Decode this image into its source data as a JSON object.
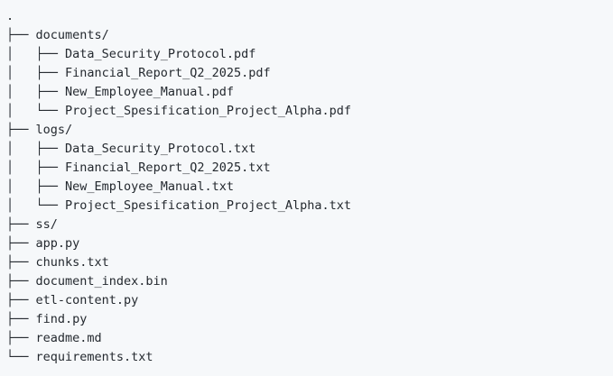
{
  "tree": {
    "lines": [
      {
        "prefix": ".",
        "name": ""
      },
      {
        "prefix": "├── ",
        "name": "documents/"
      },
      {
        "prefix": "│   ├── ",
        "name": "Data_Security_Protocol.pdf"
      },
      {
        "prefix": "│   ├── ",
        "name": "Financial_Report_Q2_2025.pdf"
      },
      {
        "prefix": "│   ├── ",
        "name": "New_Employee_Manual.pdf"
      },
      {
        "prefix": "│   └── ",
        "name": "Project_Spesification_Project_Alpha.pdf"
      },
      {
        "prefix": "├── ",
        "name": "logs/"
      },
      {
        "prefix": "│   ├── ",
        "name": "Data_Security_Protocol.txt"
      },
      {
        "prefix": "│   ├── ",
        "name": "Financial_Report_Q2_2025.txt"
      },
      {
        "prefix": "│   ├── ",
        "name": "New_Employee_Manual.txt"
      },
      {
        "prefix": "│   └── ",
        "name": "Project_Spesification_Project_Alpha.txt"
      },
      {
        "prefix": "├── ",
        "name": "ss/"
      },
      {
        "prefix": "├── ",
        "name": "app.py"
      },
      {
        "prefix": "├── ",
        "name": "chunks.txt"
      },
      {
        "prefix": "├── ",
        "name": "document_index.bin"
      },
      {
        "prefix": "├── ",
        "name": "etl-content.py"
      },
      {
        "prefix": "├── ",
        "name": "find.py"
      },
      {
        "prefix": "├── ",
        "name": "readme.md"
      },
      {
        "prefix": "└── ",
        "name": "requirements.txt"
      }
    ]
  }
}
